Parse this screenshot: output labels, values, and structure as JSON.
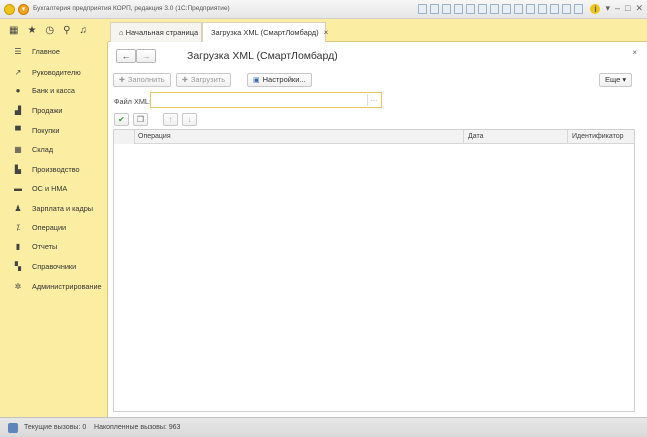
{
  "window": {
    "title": "Бухгалтерия предприятия КОРП, редакция 3.0 (1С:Предприятие)"
  },
  "tabs": {
    "home": "Начальная страница",
    "active": "Загрузка XML (СмартЛомбард)"
  },
  "sidebar": {
    "items": [
      {
        "label": "Главное",
        "icon": "menu-icon"
      },
      {
        "label": "Руководителю",
        "icon": "trend-icon"
      },
      {
        "label": "Банк и касса",
        "icon": "bank-icon"
      },
      {
        "label": "Продажи",
        "icon": "sales-icon"
      },
      {
        "label": "Покупки",
        "icon": "cart-icon"
      },
      {
        "label": "Склад",
        "icon": "warehouse-icon"
      },
      {
        "label": "Производство",
        "icon": "factory-icon"
      },
      {
        "label": "ОС и НМА",
        "icon": "truck-icon"
      },
      {
        "label": "Зарплата и кадры",
        "icon": "person-icon"
      },
      {
        "label": "Операции",
        "icon": "operations-icon"
      },
      {
        "label": "Отчеты",
        "icon": "chart-icon"
      },
      {
        "label": "Справочники",
        "icon": "book-icon"
      },
      {
        "label": "Администрирование",
        "icon": "gear-icon"
      }
    ]
  },
  "form": {
    "title": "Загрузка XML (СмартЛомбард)",
    "fill_label": "Заполнить",
    "load_label": "Загрузить",
    "settings_label": "Настройки...",
    "more_label": "Еще",
    "file_label": "Файл XML:",
    "file_value": ""
  },
  "table": {
    "columns": [
      "Операция",
      "Дата",
      "Идентификатор"
    ],
    "rows": []
  },
  "status": {
    "text": "Текущие вызовы: 0    Накопленные вызовы: 963"
  }
}
